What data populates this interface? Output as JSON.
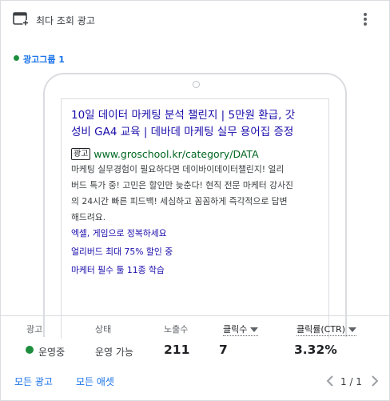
{
  "header": {
    "title": "최다 조회 광고",
    "icon": "browser-add-icon",
    "menu_icon": "more-vert-icon"
  },
  "ad_group": {
    "label": "광고그룹 1",
    "status_color": "#1e8e3e"
  },
  "ad": {
    "headline_line1": "10일 데이터 마케팅 분석 챌린지 | 5만원 환급, 갓",
    "headline_line2": "성비 GA4 교육 | 데바데 마케팅 실무 용어집 증정",
    "badge": "광고",
    "display_url": "www.groschool.kr/category/DATA",
    "description": [
      "마케팅 실무경험이 필요하다면 데이바이데이터챌린지! 얼리",
      "버드 특가 중! 고민은 할인만 늦춘다! 현직 전문 마케터 강사진",
      "의 24시간 빠른 피드백! 세심하고 꼼꼼하게 즉각적으로 답변",
      "해드려요."
    ],
    "sitelinks": [
      "엑셀, 게임으로 정복하세요",
      "얼리버드 최대 75% 할인 중",
      "마케터 필수 툴 11종 학습"
    ]
  },
  "stats": {
    "headers": {
      "ad": "광고",
      "status": "상태",
      "impressions": "노출수",
      "clicks": "클릭수",
      "ctr": "클릭률(CTR)"
    },
    "values": {
      "ad": "운영중",
      "status": "운영 가능",
      "impressions": "211",
      "clicks": "7",
      "ctr": "3.32%"
    }
  },
  "footer": {
    "all_ads": "모든 광고",
    "all_assets": "모든 애셋",
    "pagination": "1 / 1",
    "prev_icon": "chevron-left-icon",
    "next_icon": "chevron-right-icon"
  }
}
